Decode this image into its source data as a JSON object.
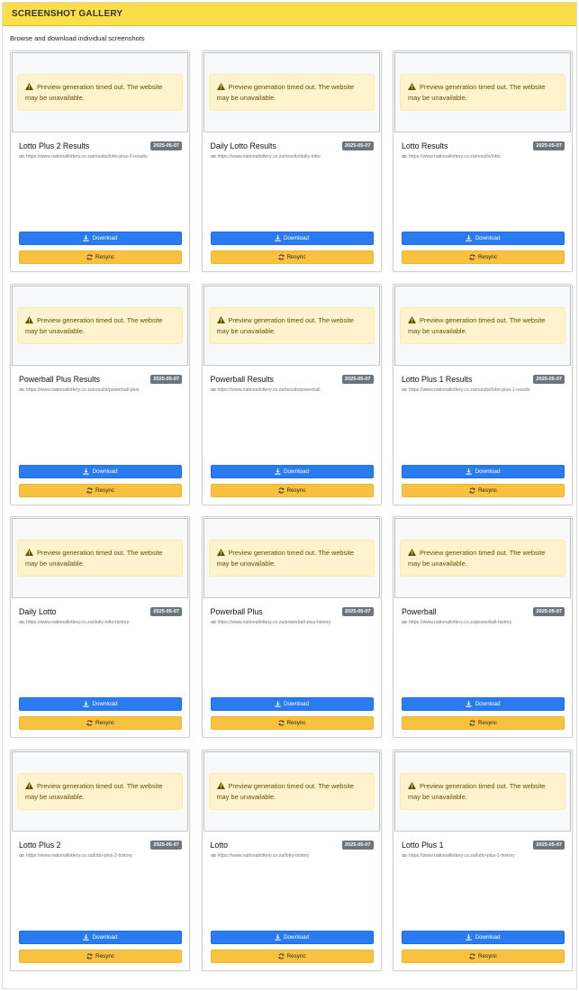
{
  "panel": {
    "title": "SCREENSHOT GALLERY",
    "subtitle": "Browse and download individual screenshots"
  },
  "alert_text": "Preview generation timed out. The website may be unavailable.",
  "button_labels": {
    "download": "Download",
    "resync": "Resync"
  },
  "colors": {
    "header": "#fbdf4a",
    "download": "#2b7bf0",
    "resync": "#f8c13f",
    "badge": "#6c757d",
    "alert_bg": "#fff3cd"
  },
  "cards": [
    {
      "title": "Lotto Plus 2 Results",
      "date": "2025-05-07",
      "url": "https://www.nationallottery.co.za/results/lotto-plus-2-results"
    },
    {
      "title": "Daily Lotto Results",
      "date": "2025-05-07",
      "url": "https://www.nationallottery.co.za/results/daily-lotto"
    },
    {
      "title": "Lotto Results",
      "date": "2025-05-07",
      "url": "https://www.nationallottery.co.za/results/lotto"
    },
    {
      "title": "Powerball Plus Results",
      "date": "2025-05-07",
      "url": "https://www.nationallottery.co.za/results/powerball-plus"
    },
    {
      "title": "Powerball Results",
      "date": "2025-05-07",
      "url": "https://www.nationallottery.co.za/results/powerball"
    },
    {
      "title": "Lotto Plus 1 Results",
      "date": "2025-05-07",
      "url": "https://www.nationallottery.co.za/results/lotto-plus-1-results"
    },
    {
      "title": "Daily Lotto",
      "date": "2025-05-07",
      "url": "https://www.nationallottery.co.za/daily-lotto-history"
    },
    {
      "title": "Powerball Plus",
      "date": "2025-05-07",
      "url": "https://www.nationallottery.co.za/powerball-plus-history"
    },
    {
      "title": "Powerball",
      "date": "2025-05-07",
      "url": "https://www.nationallottery.co.za/powerball-history"
    },
    {
      "title": "Lotto Plus 2",
      "date": "2025-05-07",
      "url": "https://www.nationallottery.co.za/lotto-plus-2-history"
    },
    {
      "title": "Lotto",
      "date": "2025-05-07",
      "url": "https://www.nationallottery.co.za/lotto-history"
    },
    {
      "title": "Lotto Plus 1",
      "date": "2025-05-07",
      "url": "https://www.nationallottery.co.za/lotto-plus-1-history"
    }
  ]
}
